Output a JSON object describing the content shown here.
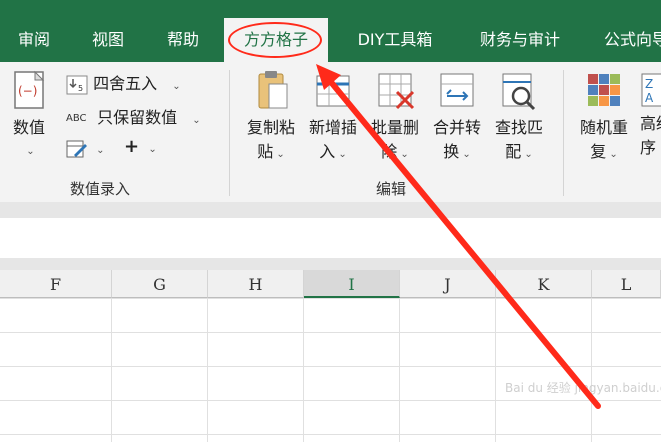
{
  "tabs": [
    {
      "label": "审阅"
    },
    {
      "label": "视图"
    },
    {
      "label": "帮助"
    },
    {
      "label": "方方格子"
    },
    {
      "label": "DIY工具箱"
    },
    {
      "label": "财务与审计"
    },
    {
      "label": "公式向导"
    }
  ],
  "ribbon": {
    "numeric_group": {
      "big_button": {
        "l1": "数值"
      },
      "round_label": "四舍五入",
      "keep_label": "只保留数值",
      "plus": "+",
      "group_label": "数值录入"
    },
    "edit_group": {
      "buttons": [
        {
          "l1": "复制粘",
          "l2": "贴"
        },
        {
          "l1": "新增插",
          "l2": "入"
        },
        {
          "l1": "批量删",
          "l2": "除"
        },
        {
          "l1": "合并转",
          "l2": "换"
        },
        {
          "l1": "查找匹",
          "l2": "配"
        }
      ],
      "group_label": "编辑"
    },
    "more_group": {
      "buttons": [
        {
          "l1": "随机重",
          "l2": "复"
        },
        {
          "l1": "高级",
          "l2": "序"
        }
      ]
    }
  },
  "columns": [
    "F",
    "G",
    "H",
    "I",
    "J",
    "K",
    "L"
  ],
  "selected_column": "I",
  "watermark": "Bai du 经验  jingyan.baidu.com",
  "colors": {
    "excel_green": "#217346",
    "annotation_red": "#ff2a1a"
  }
}
